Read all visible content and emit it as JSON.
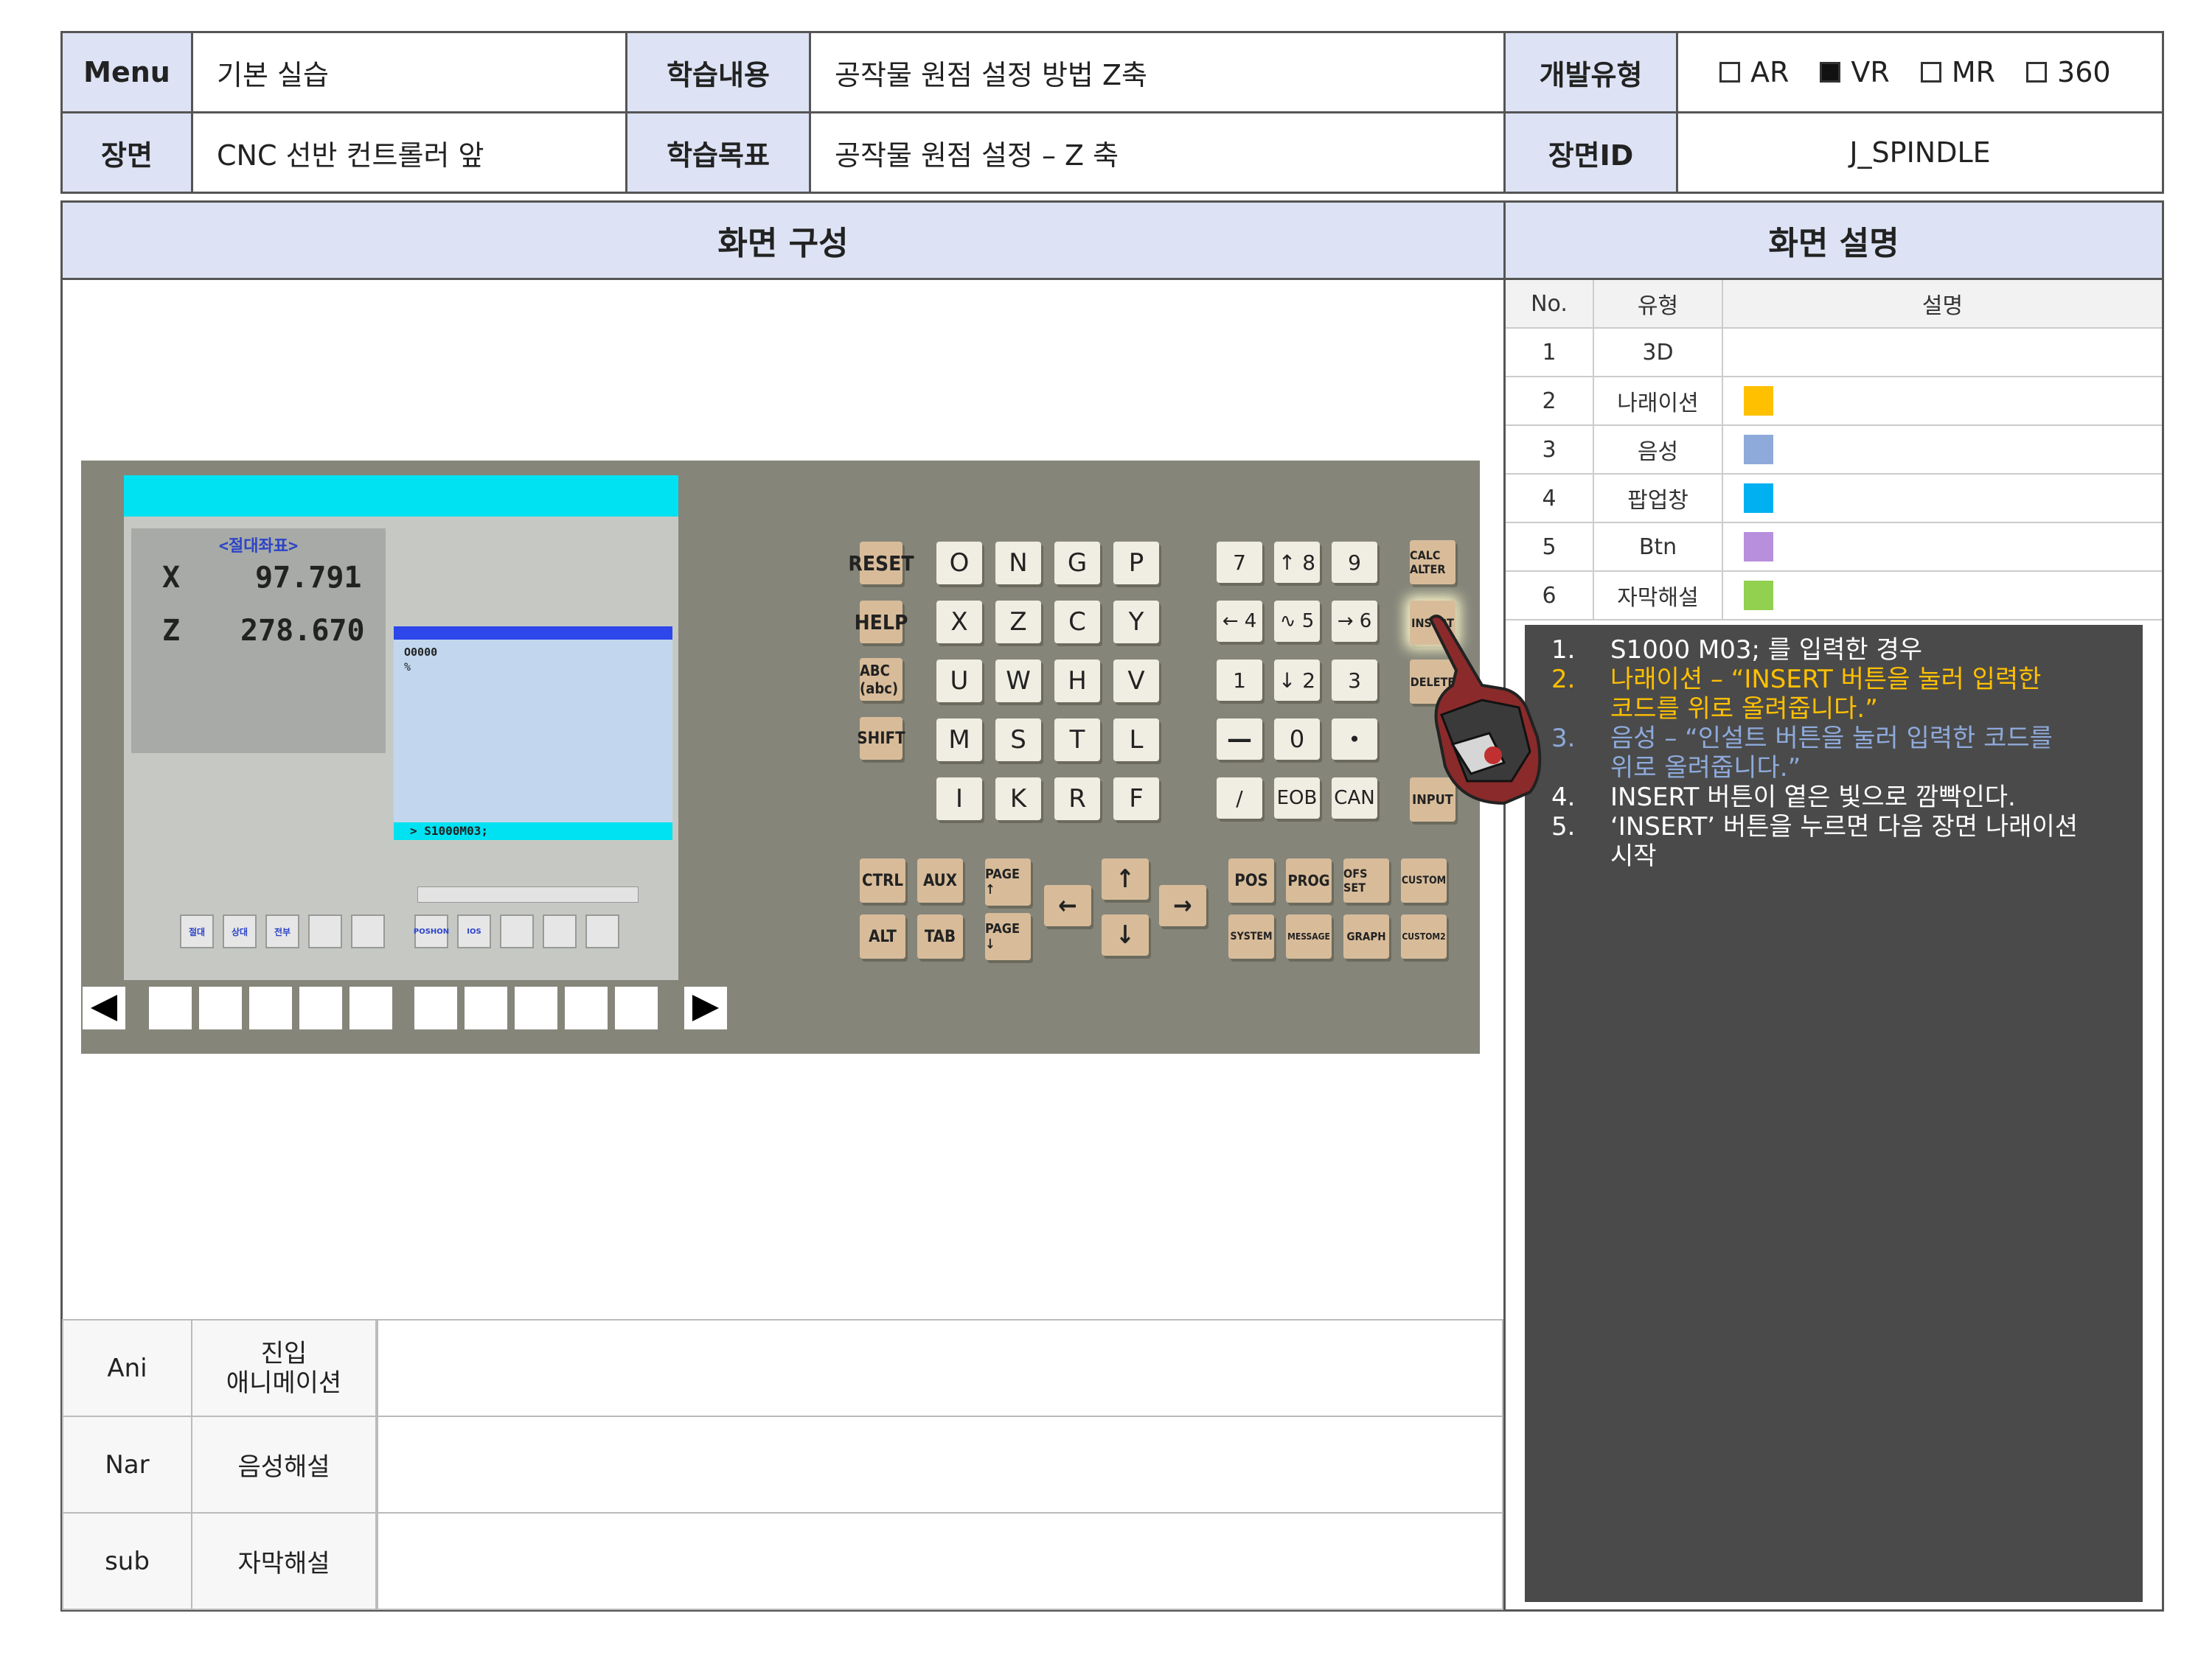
{
  "header": {
    "menu_label": "Menu",
    "menu_value": "기본 실습",
    "content_label": "학습내용",
    "content_value": "공작물 원점 설정 방법 Z축",
    "devtype_label": "개발유형",
    "devtypes": [
      {
        "label": "AR",
        "checked": false
      },
      {
        "label": "VR",
        "checked": true
      },
      {
        "label": "MR",
        "checked": false
      },
      {
        "label": "360",
        "checked": false
      }
    ],
    "scene_label": "장면",
    "scene_value": "CNC 선반 컨트롤러 앞",
    "goal_label": "학습목표",
    "goal_value": "공작물 원점 설정 – Z 축",
    "sceneid_label": "장면ID",
    "sceneid_value": "J_SPINDLE"
  },
  "sections": {
    "screen_layout": "화면 구성",
    "screen_desc": "화면 설명"
  },
  "legend": {
    "headers": [
      "No.",
      "유형",
      "설명"
    ],
    "rows": [
      {
        "no": "1",
        "type": "3D",
        "color": ""
      },
      {
        "no": "2",
        "type": "나래이션",
        "color": "#ffc000"
      },
      {
        "no": "3",
        "type": "음성",
        "color": "#8eaadb"
      },
      {
        "no": "4",
        "type": "팝업창",
        "color": "#00b0f0"
      },
      {
        "no": "5",
        "type": "Btn",
        "color": "#b88fdc"
      },
      {
        "no": "6",
        "type": "자막해설",
        "color": "#92d050"
      }
    ]
  },
  "description": {
    "items": [
      {
        "num": "1.",
        "lines": [
          "S1000 M03; 를 입력한 경우"
        ],
        "color": "#ffffff"
      },
      {
        "num": "2.",
        "lines": [
          "나래이션 – “INSERT 버튼을 눌러 입력한",
          "코드를 위로 올려줍니다.”"
        ],
        "color": "#ffc000"
      },
      {
        "num": "3.",
        "lines": [
          "음성 – “인설트 버튼을 눌러 입력한 코드를",
          "위로 올려줍니다.”"
        ],
        "color": "#8eaadb"
      },
      {
        "num": "4.",
        "lines": [
          "INSERT 버튼이 옅은 빛으로 깜빡인다."
        ],
        "color": "#ffffff"
      },
      {
        "num": "5.",
        "lines": [
          "‘INSERT’ 버튼을 누르면 다음 장면 나래이션",
          "시작"
        ],
        "color": "#ffffff"
      }
    ]
  },
  "cnc": {
    "coord_title": "<절대좌표>",
    "x_label": "X",
    "x_value": "97.791",
    "z_label": "Z",
    "z_value": "278.670",
    "program_no": "O0000",
    "program_end": "%",
    "input_line": "> S1000M03;",
    "softkeys_left": [
      "절대",
      "상대",
      "전부",
      "",
      ""
    ],
    "softkeys_right": [
      "POSHON",
      "IOS",
      "",
      "",
      ""
    ]
  },
  "keypad": {
    "fn_left": [
      "RESET",
      "HELP",
      "ABC (abc)",
      "SHIFT"
    ],
    "alpha": [
      [
        "O",
        "N",
        "G",
        "P"
      ],
      [
        "X",
        "Z",
        "C",
        "Y"
      ],
      [
        "U",
        "W",
        "H",
        "V"
      ],
      [
        "M",
        "S",
        "T",
        "L"
      ],
      [
        "I",
        "K",
        "R",
        "F"
      ]
    ],
    "num": [
      [
        "7",
        "↑ 8",
        "9"
      ],
      [
        "← 4",
        "∿ 5",
        "→ 6"
      ],
      [
        "1",
        "↓ 2",
        "3"
      ],
      [
        "—",
        "0",
        "•"
      ],
      [
        "/",
        "EOB",
        "CAN"
      ]
    ],
    "fn_right": [
      "CALC ALTER",
      "INSERT",
      "DELETE",
      "",
      "INPUT"
    ],
    "bottom_left": [
      [
        "CTRL",
        "AUX"
      ],
      [
        "ALT",
        "TAB"
      ]
    ],
    "page": [
      "PAGE ↑",
      "PAGE ↓"
    ],
    "arrows": [
      "←",
      "↑",
      "↓",
      "→"
    ],
    "bottom_right": [
      [
        "POS",
        "PROG",
        "OFS SET",
        "CUSTOM"
      ],
      [
        "SYSTEM",
        "MESSAGE",
        "GRAPH",
        "CUSTOM2"
      ]
    ]
  },
  "bottom_rows": [
    {
      "code": "Ani",
      "label": "진입\n애니메이션"
    },
    {
      "code": "Nar",
      "label": "음성해설"
    },
    {
      "code": "sub",
      "label": "자막해설"
    }
  ]
}
